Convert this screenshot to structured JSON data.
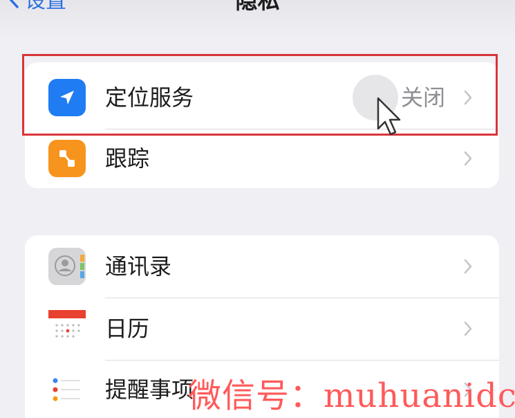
{
  "nav": {
    "back_label": "设置",
    "title": "隐私"
  },
  "group1": [
    {
      "label": "定位服务",
      "value": "关闭",
      "icon": "location-arrow-icon",
      "color": "#1f7cf2"
    },
    {
      "label": "跟踪",
      "value": "",
      "icon": "tracking-icon",
      "color": "#f7941d"
    }
  ],
  "group2": [
    {
      "label": "通讯录",
      "icon": "contacts-icon"
    },
    {
      "label": "日历",
      "icon": "calendar-icon"
    },
    {
      "label": "提醒事项",
      "icon": "reminders-icon"
    }
  ],
  "highlight_color": "#d9343a",
  "watermark": "微信号：muhuanidc"
}
